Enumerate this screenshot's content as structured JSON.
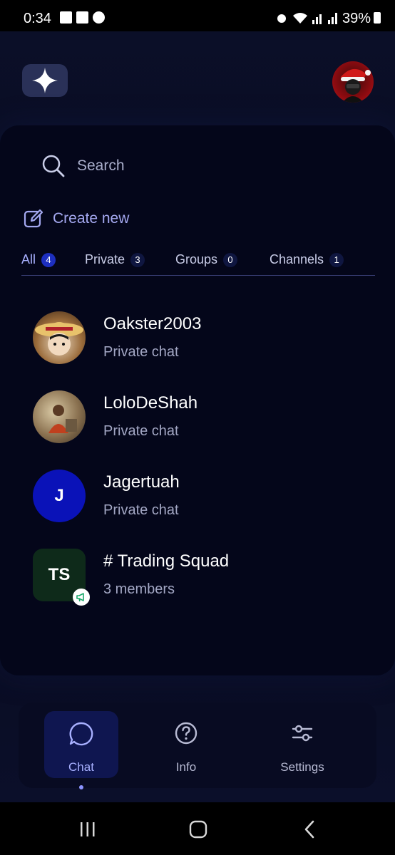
{
  "status_bar": {
    "time": "0:34",
    "battery": "39%"
  },
  "header": {
    "logo": "sparkle-logo",
    "avatar": "user-avatar"
  },
  "search": {
    "placeholder": "Search"
  },
  "create_new": {
    "label": "Create new"
  },
  "tabs": [
    {
      "label": "All",
      "count": "4",
      "active": true
    },
    {
      "label": "Private",
      "count": "3"
    },
    {
      "label": "Groups",
      "count": "0"
    },
    {
      "label": "Channels",
      "count": "1"
    }
  ],
  "chats": [
    {
      "name": "Oakster2003",
      "subtitle": "Private chat"
    },
    {
      "name": "LoloDeShah",
      "subtitle": "Private chat"
    },
    {
      "name": "Jagertuah",
      "subtitle": "Private chat",
      "initials": "J"
    },
    {
      "name": "# Trading Squad",
      "subtitle": "3 members",
      "initials": "TS"
    }
  ],
  "bottom_nav": [
    {
      "label": "Chat",
      "icon": "chat-bubble-icon",
      "active": true
    },
    {
      "label": "Info",
      "icon": "question-circle-icon"
    },
    {
      "label": "Settings",
      "icon": "sliders-icon"
    }
  ],
  "colors": {
    "accent": "#a8b0ff",
    "active_badge": "#1d2fbf",
    "background": "#070a1c",
    "jagertuah_avatar": "#0a12b8",
    "trading_avatar": "#0e2a1a"
  }
}
